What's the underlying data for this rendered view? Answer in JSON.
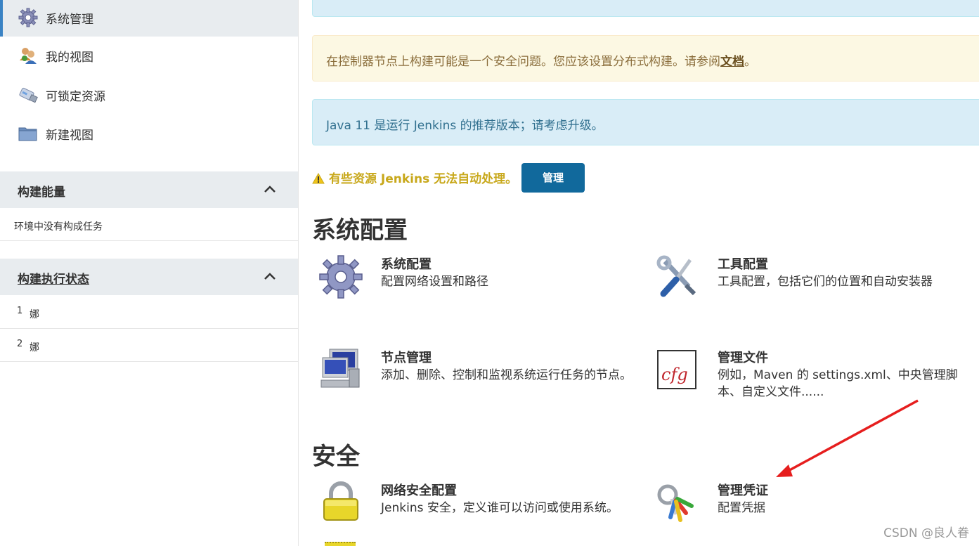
{
  "sidebar": {
    "items": [
      {
        "label": "系统管理",
        "icon": "gear-icon",
        "active": true
      },
      {
        "label": "我的视图",
        "icon": "users-icon"
      },
      {
        "label": "可锁定资源",
        "icon": "usb-drive-icon"
      },
      {
        "label": "新建视图",
        "icon": "folder-icon"
      }
    ],
    "build_queue": {
      "title": "构建能量",
      "empty_text": "环境中没有构成任务"
    },
    "executors": {
      "title": "构建执行状态",
      "rows": [
        {
          "num": "1",
          "status": "娜"
        },
        {
          "num": "2",
          "status": "娜"
        }
      ]
    }
  },
  "alerts": {
    "warning": {
      "text": "在控制器节点上构建可能是一个安全问题。您应该设置分布式构建。请参阅",
      "link": "文档",
      "suffix": "。"
    },
    "java": {
      "text": "Java 11 是运行 Jenkins 的推荐版本；请考虑升级。"
    }
  },
  "resource_warning": {
    "text": "有些资源 Jenkins 无法自动处理。",
    "button": "管理"
  },
  "sections": {
    "system_config": {
      "title": "系统配置",
      "tiles": [
        {
          "name": "系统配置",
          "desc": "配置网络设置和路径",
          "icon": "gear-icon"
        },
        {
          "name": "工具配置",
          "desc": "工具配置，包括它们的位置和自动安装器",
          "icon": "tools-icon"
        },
        {
          "name": "节点管理",
          "desc": "添加、删除、控制和监视系统运行任务的节点。",
          "icon": "computer-icon"
        },
        {
          "name": "管理文件",
          "desc": "例如，Maven 的 settings.xml、中央管理脚本、自定义文件......",
          "icon": "cfg-file-icon"
        }
      ]
    },
    "security": {
      "title": "安全",
      "tiles": [
        {
          "name": "网络安全配置",
          "desc": "Jenkins 安全，定义谁可以访问或使用系统。",
          "icon": "lock-icon"
        },
        {
          "name": "管理凭证",
          "desc": "配置凭据",
          "icon": "keys-icon"
        }
      ]
    }
  },
  "watermark": "CSDN @良人眷",
  "colors": {
    "primary_button": "#11699c",
    "annotation_arrow": "#e61e1e",
    "active_border": "#3a83c4"
  }
}
